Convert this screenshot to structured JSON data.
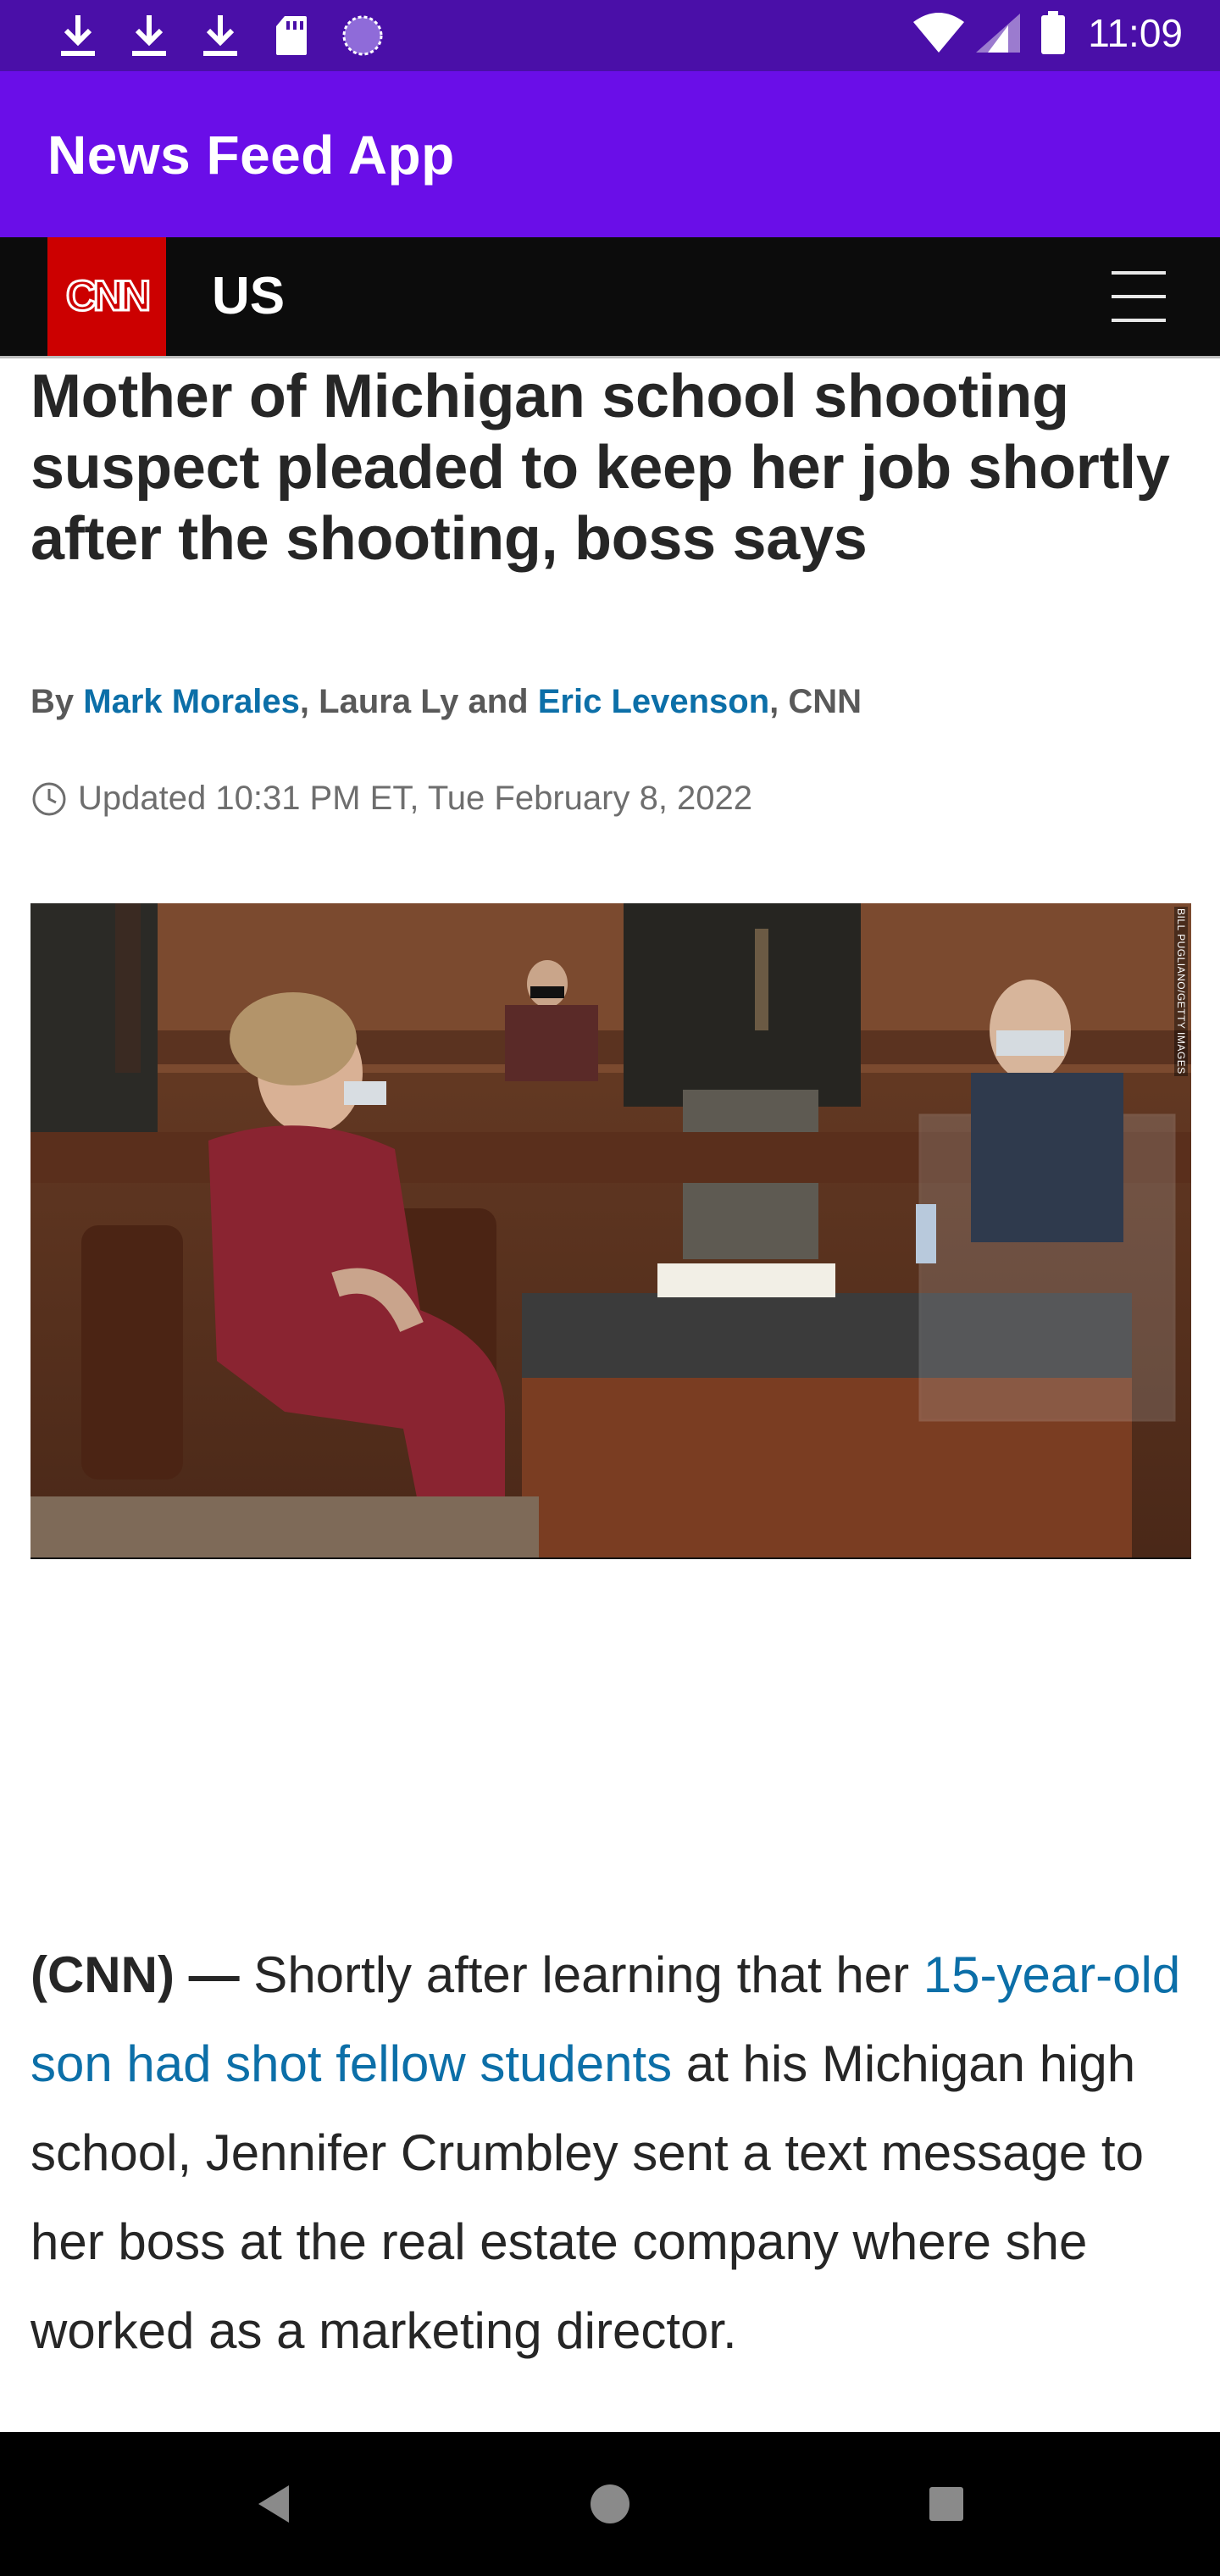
{
  "status_bar": {
    "time": "11:09",
    "left_icons": [
      "download-icon",
      "download-icon",
      "download-icon",
      "sd-card-icon",
      "loading-circle-icon"
    ],
    "right_icons": [
      "wifi-icon",
      "signal-icon",
      "battery-icon"
    ]
  },
  "app_bar": {
    "title": "News Feed App",
    "color": "#6a0ee8"
  },
  "cnn_nav": {
    "logo_text": "CNN",
    "logo_color": "#cc0000",
    "section": "US",
    "menu_icon": "hamburger-menu-icon"
  },
  "article": {
    "headline": "Mother of Michigan school shooting suspect pleaded to keep her job shortly after the shooting, boss says",
    "byline": {
      "prefix": "By ",
      "author1": "Mark Morales",
      "sep1": ", Laura Ly and ",
      "author2": "Eric Levenson",
      "suffix": ", CNN"
    },
    "updated": "Updated 10:31 PM ET, Tue February 8, 2022",
    "photo_credit": "BILL PUGLIANO/GETTY IMAGES",
    "body": {
      "dateline": "(CNN) —",
      "text_before_link": " Shortly after learning that her ",
      "link_text": "15-year-old son had shot fellow students",
      "text_after_link": " at his Michigan high school, Jennifer Crumbley sent a text message to her boss at the real estate company where she worked as a marketing director."
    },
    "link_color": "#0c6fa8"
  },
  "system_nav": {
    "buttons": [
      "back-icon",
      "home-icon",
      "recents-icon"
    ]
  }
}
